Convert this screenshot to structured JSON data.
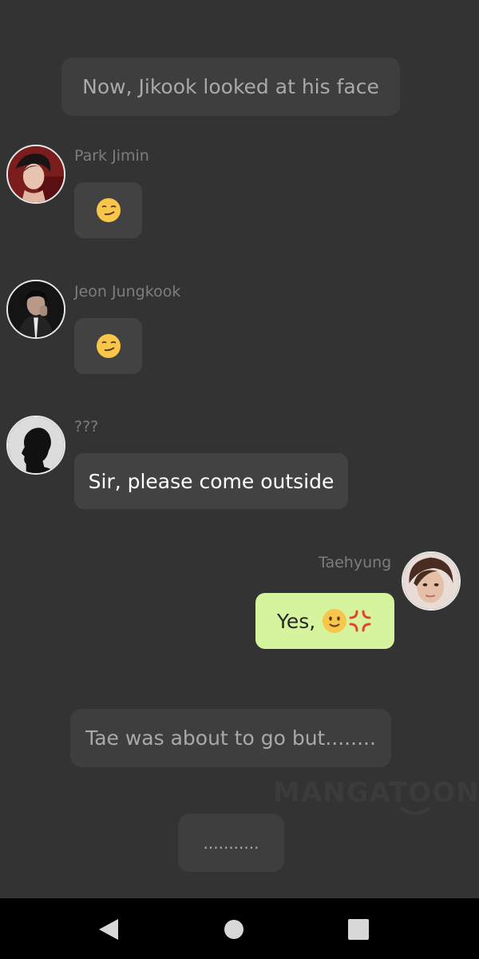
{
  "narrations": {
    "opening": "Now, Jikook looked at his face",
    "tae_leaving": "Tae was about to go but........",
    "ellipsis": "..........."
  },
  "messages": [
    {
      "speaker": "Park Jimin",
      "text": "",
      "emoji": "smirking-face"
    },
    {
      "speaker": "Jeon Jungkook",
      "text": "",
      "emoji": "smirking-face"
    },
    {
      "speaker": "???",
      "text": "Sir, please come outside"
    },
    {
      "speaker": "Taehyung",
      "text": "Yes, ",
      "emoji": [
        "slightly-smiling-face",
        "anger-symbol"
      ],
      "mine": true
    }
  ],
  "watermark": "MANGATOON",
  "navigation": {
    "back": "back-icon",
    "home": "home-icon",
    "recents": "recents-icon"
  },
  "colors": {
    "background": "#333333",
    "bubble": "#424242",
    "my_bubble": "#d6f49e",
    "narration": "#3e3e3e",
    "narration_text": "#a9a9a9"
  }
}
